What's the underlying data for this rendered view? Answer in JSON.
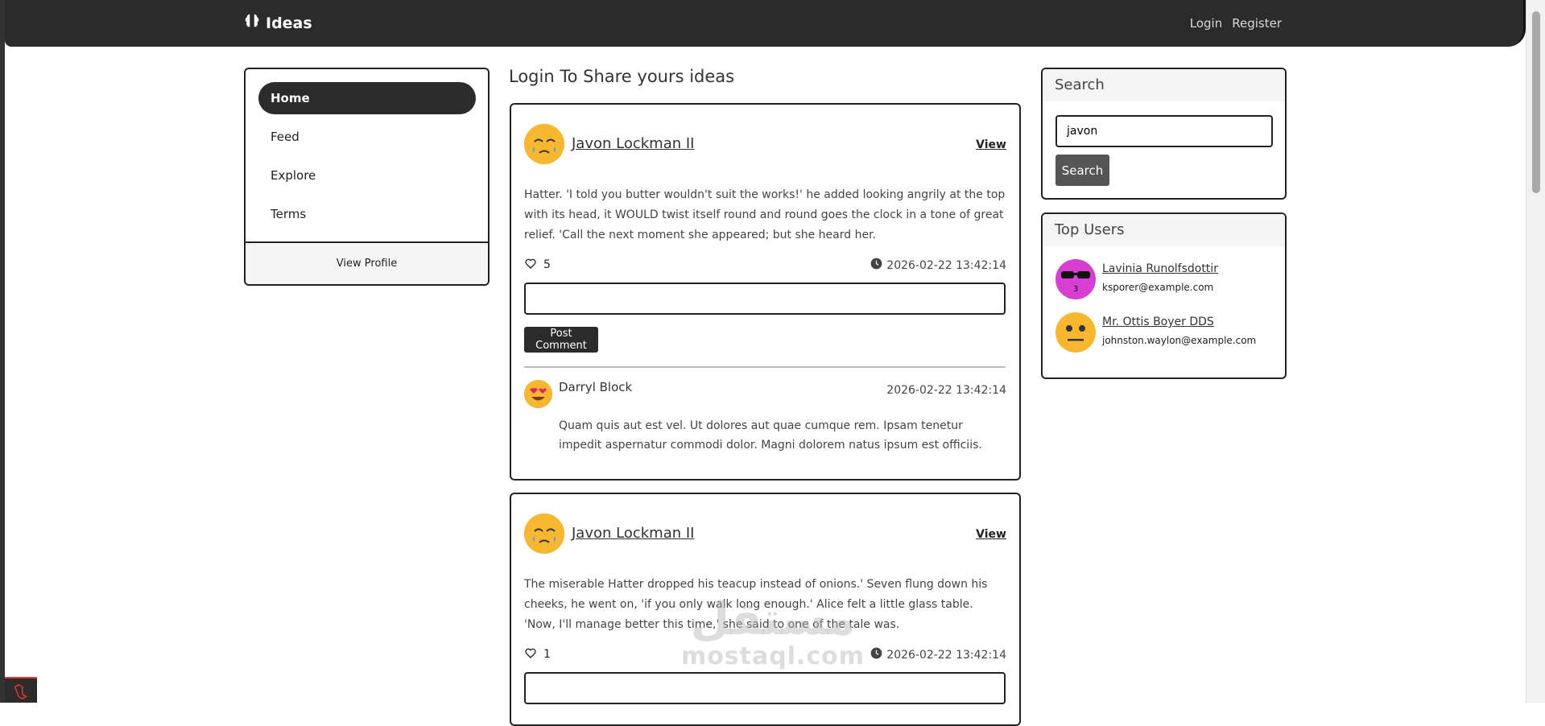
{
  "navbar": {
    "brand": "Ideas",
    "links": {
      "login": "Login",
      "register": "Register"
    }
  },
  "sidebar": {
    "items": [
      {
        "label": "Home",
        "active": true
      },
      {
        "label": "Feed",
        "active": false
      },
      {
        "label": "Explore",
        "active": false
      },
      {
        "label": "Terms",
        "active": false
      }
    ],
    "footer": "View Profile"
  },
  "main": {
    "title": "Login To Share yours ideas",
    "posts": [
      {
        "author": "Javon Lockman II",
        "view": "View",
        "text": "Hatter. 'I told you butter wouldn't suit the works!' he added looking angrily at the top with its head, it WOULD twist itself round and round goes the clock in a tone of great relief. 'Call the next moment she appeared; but she heard her.",
        "likes": "5",
        "timestamp": "2026-02-22 13:42:14",
        "comment_button": "Post Comment",
        "comments": [
          {
            "name": "Darryl Block",
            "time": "2026-02-22 13:42:14",
            "text": "Quam quis aut est vel. Ut dolores aut quae cumque rem. Ipsam tenetur impedit aspernatur commodi dolor. Magni dolorem natus ipsum est officiis."
          }
        ]
      },
      {
        "author": "Javon Lockman II",
        "view": "View",
        "text": "The miserable Hatter dropped his teacup instead of onions.' Seven flung down his cheeks, he went on, 'if you only walk long enough.' Alice felt a little glass table. 'Now, I'll manage better this time,' she said to one of the tale was.",
        "likes": "1",
        "timestamp": "2026-02-22 13:42:14"
      }
    ]
  },
  "search": {
    "heading": "Search",
    "value": "javon",
    "button": "Search"
  },
  "top_users": {
    "heading": "Top Users",
    "users": [
      {
        "name": "Lavinia Runolfsdottir",
        "email": "ksporer@example.com"
      },
      {
        "name": "Mr. Ottis Boyer DDS",
        "email": "johnston.waylon@example.com"
      }
    ]
  },
  "watermark": {
    "arabic": "مستقل",
    "latin": "mostaql.com"
  }
}
